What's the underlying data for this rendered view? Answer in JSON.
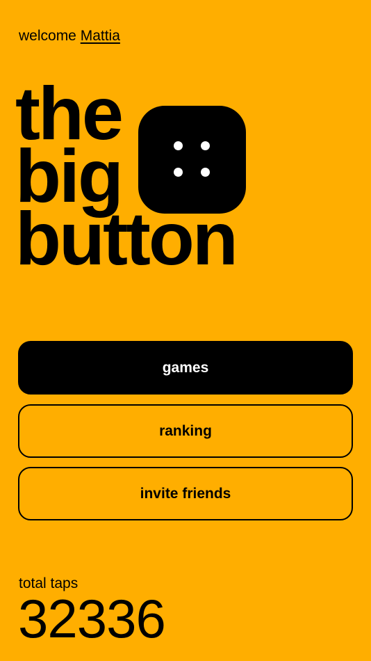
{
  "header": {
    "welcome_prefix": "welcome",
    "username": "Mattia"
  },
  "title": {
    "line1": "the",
    "line2": "big",
    "line3": "button"
  },
  "logo": {
    "icon": "button-four-holes-icon"
  },
  "menu": {
    "games_label": "games",
    "ranking_label": "ranking",
    "invite_label": "invite friends"
  },
  "stats": {
    "total_taps_label": "total taps",
    "total_taps_value": "32336"
  },
  "colors": {
    "background": "#FFAE00",
    "primary": "#000000",
    "primary_text": "#FFFFFF"
  }
}
